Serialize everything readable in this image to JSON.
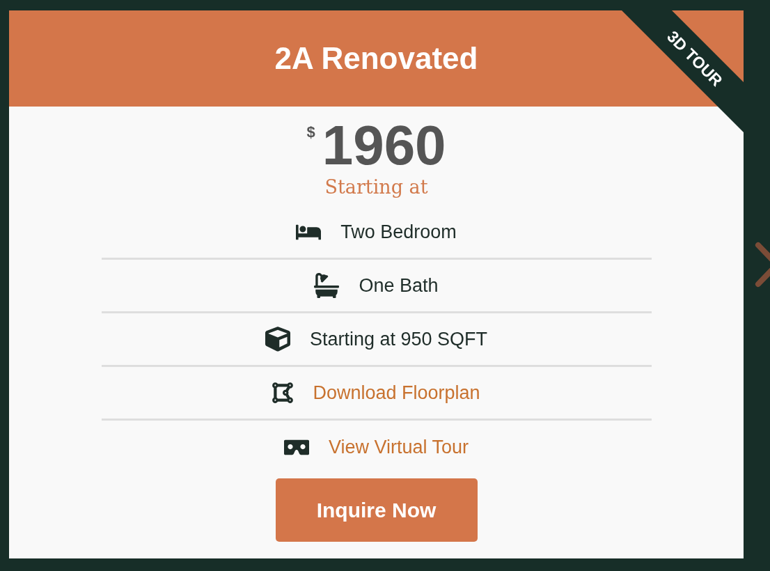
{
  "card": {
    "title": "2A Renovated",
    "ribbon": "3D TOUR",
    "price": {
      "currency": "$",
      "amount": "1960",
      "caption": "Starting at"
    },
    "features": [
      {
        "kind": "text",
        "label": "Two Bedroom"
      },
      {
        "kind": "text",
        "label": "One Bath"
      },
      {
        "kind": "text",
        "label": "Starting at 950 SQFT"
      },
      {
        "kind": "link",
        "label": "Download Floorplan"
      },
      {
        "kind": "link",
        "label": "View Virtual Tour"
      }
    ],
    "button": "Inquire Now"
  }
}
